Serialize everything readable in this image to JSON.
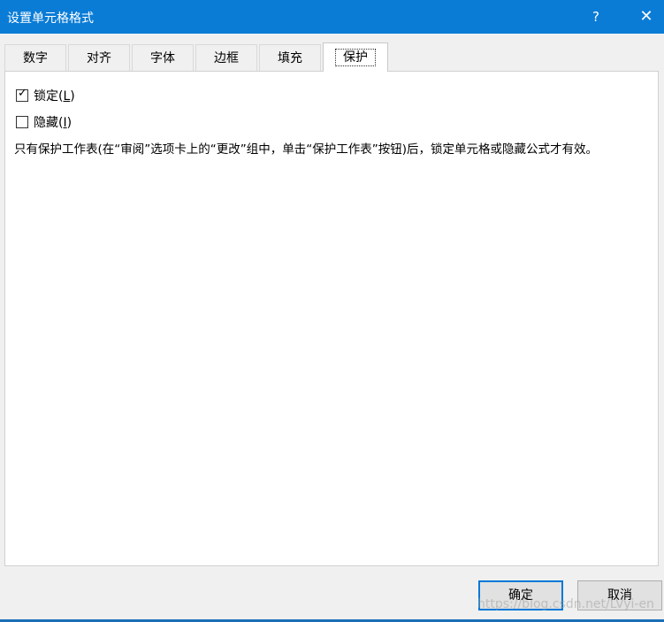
{
  "window": {
    "title": "设置单元格格式",
    "help_label": "?",
    "close_label": "✕"
  },
  "tabs": [
    {
      "label": "数字"
    },
    {
      "label": "对齐"
    },
    {
      "label": "字体"
    },
    {
      "label": "边框"
    },
    {
      "label": "填充"
    },
    {
      "label": "保护",
      "active": true
    }
  ],
  "protection": {
    "locked": {
      "label": "锁定(",
      "accesskey": "L",
      "suffix": ")",
      "checked": true,
      "check_glyph": "✓"
    },
    "hidden": {
      "label": "隐藏(",
      "accesskey": "I",
      "suffix": ")",
      "checked": false
    },
    "info_text": "只有保护工作表(在“审阅”选项卡上的“更改”组中，单击“保护工作表”按钮)后，锁定单元格或隐藏公式才有效。"
  },
  "footer": {
    "ok_label": "确定",
    "cancel_label": "取消",
    "watermark": "https://blog.csdn.net/LVyi-en"
  },
  "colors": {
    "titlebar": "#0a7cd6",
    "accent": "#0078d7"
  }
}
